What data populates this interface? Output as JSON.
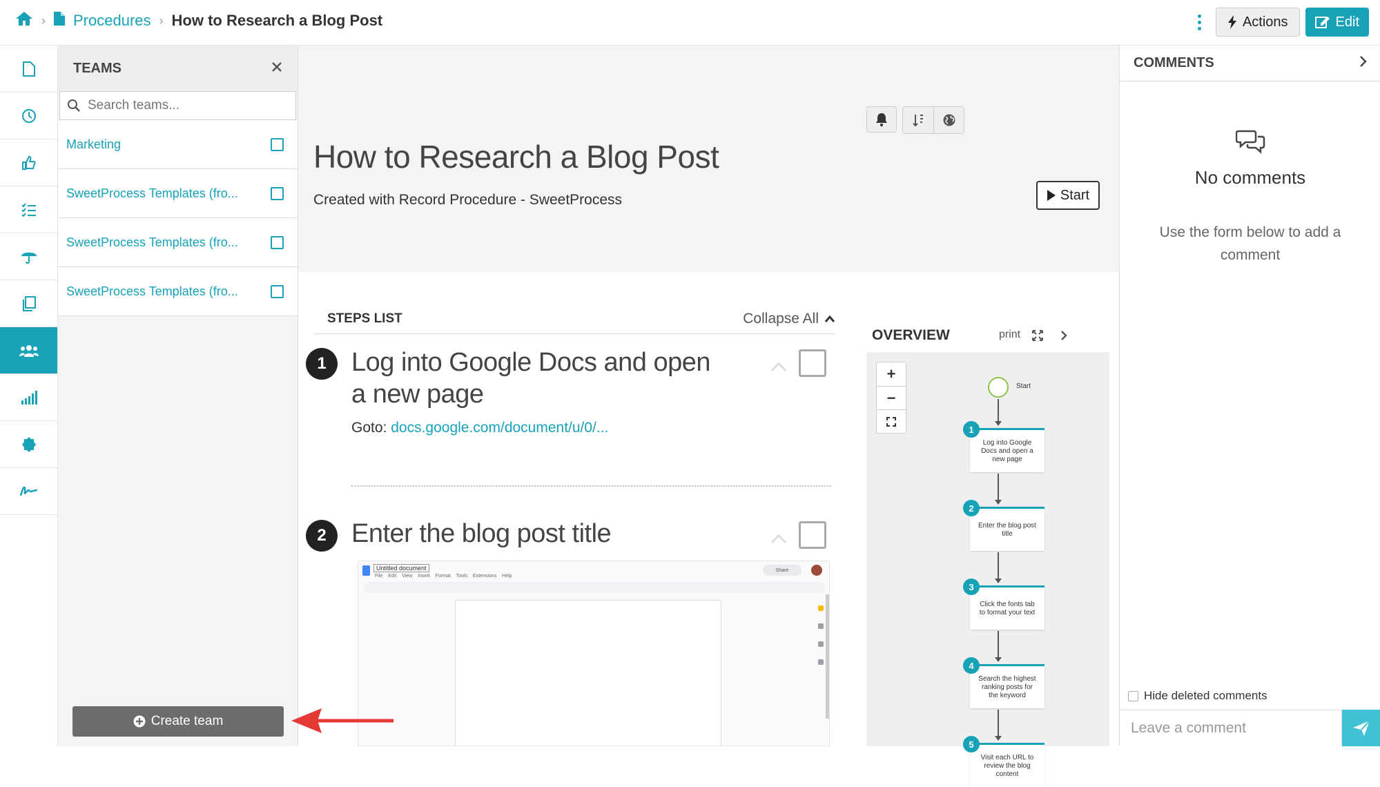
{
  "breadcrumb": {
    "parent": "Procedures",
    "current": "How to Research a Blog Post"
  },
  "topbar": {
    "actions_label": "Actions",
    "edit_label": "Edit"
  },
  "teams_panel": {
    "title": "TEAMS",
    "search_placeholder": "Search teams...",
    "teams": [
      {
        "name": "Marketing"
      },
      {
        "name": "SweetProcess Templates (fro..."
      },
      {
        "name": "SweetProcess Templates (fro..."
      },
      {
        "name": "SweetProcess Templates (fro..."
      }
    ],
    "create_label": "Create team"
  },
  "procedure": {
    "title": "How to Research a Blog Post",
    "subtitle": "Created with Record Procedure - SweetProcess",
    "start_label": "Start"
  },
  "steps": {
    "header": "STEPS LIST",
    "collapse_label": "Collapse All",
    "items": [
      {
        "number": "1",
        "title": "Log into Google Docs and open a new page",
        "goto_label": "Goto:",
        "goto_link": "docs.google.com/document/u/0/..."
      },
      {
        "number": "2",
        "title": "Enter the blog post title"
      }
    ]
  },
  "screenshot_doc": {
    "doc_title": "Untitled document",
    "menu": "File Edit View Insert Format Tools Extensions Help",
    "share": "Share"
  },
  "overview": {
    "title": "OVERVIEW",
    "print_label": "print",
    "start_label": "Start",
    "nodes": [
      {
        "number": "1",
        "label": "Log into Google Docs and open a new page"
      },
      {
        "number": "2",
        "label": "Enter the blog post title"
      },
      {
        "number": "3",
        "label": "Click the fonts tab to format your text"
      },
      {
        "number": "4",
        "label": "Search the highest ranking posts for the keyword"
      },
      {
        "number": "5",
        "label": "Visit each URL to review the blog content"
      }
    ]
  },
  "comments": {
    "title": "COMMENTS",
    "empty_title": "No comments",
    "empty_sub": "Use the form below to add a comment",
    "hide_deleted": "Hide deleted comments",
    "input_placeholder": "Leave a comment"
  },
  "colors": {
    "accent": "#17a2b8",
    "annotation_arrow": "#e53935"
  }
}
